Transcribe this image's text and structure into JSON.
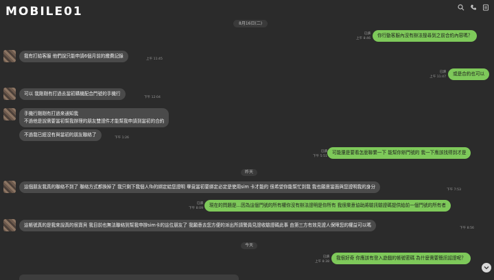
{
  "app": {
    "logo_text": "MOBILE01"
  },
  "top_icons": [
    "search-icon",
    "phone-icon",
    "menu-icon"
  ],
  "date_header": "8月16日(二)",
  "day_dividers": [
    "昨天",
    "今天"
  ],
  "messages": [
    {
      "side": "out",
      "text": "你行動客服內沒有辦法搜尋到之前合約內容嗎？",
      "read": "已讀",
      "time": "上午 8:46"
    },
    {
      "side": "in",
      "text": "我有打給客服 他們說只能申請6個月前的繳費記錄",
      "time": "上午 11:45"
    },
    {
      "side": "out",
      "text": "或是合約也可以",
      "read": "已讀",
      "time": "上午 11:47"
    },
    {
      "side": "in",
      "text": "可以 我剛剛有打過去當初購機配合門號的手機行",
      "time": "下午 12:04"
    },
    {
      "side": "in",
      "text_lines": [
        "手機行剛剛有打過來通知我",
        "不過他是說需要當初幫我辦理的朋友雙證件才能幫我申請到當初的合約"
      ]
    },
    {
      "side": "in",
      "text": "不過我已經沒有與當初的朋友聯絡了",
      "time": "下午 1:26"
    },
    {
      "side": "out",
      "text": "可能還是要看怎麼聯繫一下 能幫你辦門號的 我一下應該找得到才是",
      "read": "已讀",
      "time": "下午 5:51"
    },
    {
      "side": "in",
      "text": "這個朋友我真的聯絡不到了 聯絡方式都換掉了 我只剩下我個人fb的綁定給您證明 畢竟當初要綁定必定是使用sim 卡才能的 很希望你能幫忙到我 我也願意當面與您證明我的身分",
      "time": "下午 7:53"
    },
    {
      "side": "out",
      "text": "現在的問題是…因為這個門號的所有權你沒有辦法證明是你所有 我很樂意協助將驗訊驗證碼提供給前一個門號的所有者",
      "read": "已讀",
      "time": "下午 8:09"
    },
    {
      "side": "in",
      "text": "這帳號真的是我來說真的很寶貝 我目前也無法聯絡到幫我申辦sim卡的這位朋友了 我願意去您方便的派出所請警員見證收驗證碼此事 由第三方有效見證人保障您的權益可以嗎",
      "time": "下午 8:56"
    },
    {
      "side": "out",
      "text": "我很好奇 你應該有登入遊戲的帳號密碼 為什麼需要簡訊認證呢？",
      "read": "已讀",
      "time": "上午 8:38"
    }
  ]
}
